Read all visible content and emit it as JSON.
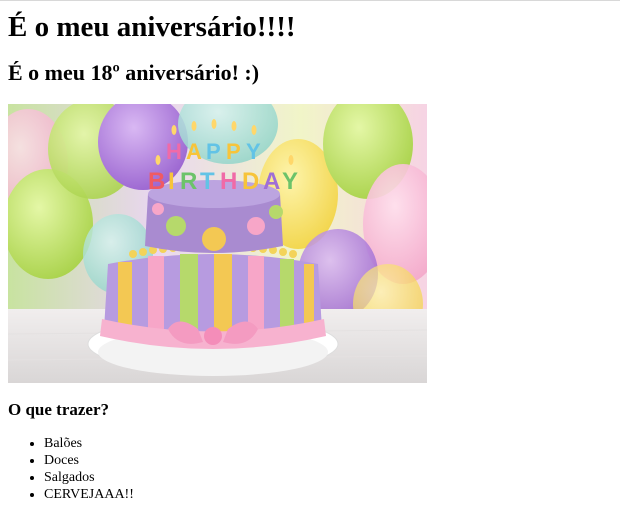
{
  "page": {
    "heading1": "É o meu aniversário!!!!",
    "heading2": "É o meu 18º aniversário! :)",
    "image": {
      "subject": "birthday cake with colorful balloons",
      "candle_text_line1": "HAPPY",
      "candle_text_line2": "BIRTHDAY"
    },
    "list_title": "O que trazer?",
    "items": [
      "Balões",
      "Doces",
      "Salgados",
      "CERVEJAAA!!"
    ]
  },
  "colors": {
    "text": "#000000",
    "cake_purple": "#a98bd0",
    "cake_pink": "#f4a6c6",
    "cake_green": "#b7d96a",
    "cake_yellow": "#f5d45e"
  }
}
